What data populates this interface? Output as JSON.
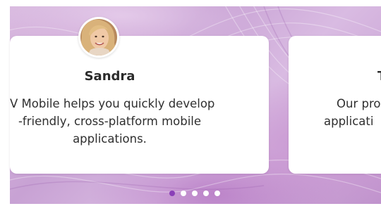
{
  "carousel": {
    "slides": [
      {
        "name": "Sandra",
        "quote_lines": [
          "V Mobile helps you quickly develop",
          "-friendly, cross-platform mobile",
          "applications."
        ]
      },
      {
        "name": "T",
        "quote_lines": [
          "Our pro",
          "applicati"
        ]
      }
    ],
    "page_count": 5,
    "active_page": 1
  },
  "colors": {
    "active_dot": "#8a3fb8",
    "inactive_dot": "#ffffff",
    "card_background": "#ffffff",
    "background_tint": "#c8a2d4"
  },
  "icons": {
    "avatar": "user-photo-avatar"
  }
}
